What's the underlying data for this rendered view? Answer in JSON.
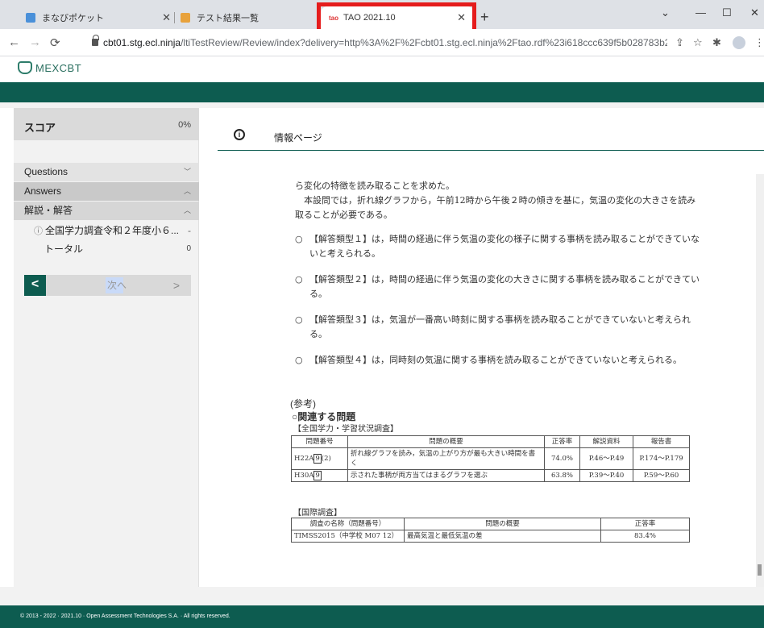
{
  "browser": {
    "tabs": [
      {
        "title": "まなびポケット",
        "state": "inactive",
        "favicon_color": "#4a90d9"
      },
      {
        "title": "テスト結果一覧",
        "state": "inactive",
        "favicon_color": "#e8a23c"
      },
      {
        "title": "TAO 2021.10",
        "state": "active",
        "favicon_text": "tao"
      }
    ],
    "url_host": "cbt01.stg.ecl.ninja",
    "url_path": "/ltiTestReview/Review/index?delivery=http%3A%2F%2Fcbt01.stg.ecl.ninja%2Ftao.rdf%23i618ccc639f5b028783b22a1d4062...",
    "highlight_color": "#e51c1c"
  },
  "app": {
    "logo_text": "MEXCBT",
    "accent_color": "#0d5c50"
  },
  "sidebar": {
    "score_label": "スコア",
    "score_value": "0%",
    "sections": [
      {
        "label": "Questions",
        "chevron": "chevron-down-icon"
      },
      {
        "label": "Answers",
        "chevron": "chevron-up-icon"
      },
      {
        "label": "解説・解答",
        "chevron": "chevron-up-icon"
      }
    ],
    "items": [
      {
        "label": "全国学力調査令和２年度小６...",
        "value": "-"
      },
      {
        "label": "トータル",
        "value": "0"
      }
    ],
    "prev_label": "<",
    "next_label": "次へ",
    "next_arrow": ">"
  },
  "main": {
    "header_title": "情報ページ",
    "intro": "ら変化の特徴を読み取ることを求めた。\n　本設問では，折れ線グラフから，午前12時から午後２時の傾きを基に，気温の変化の大きさを読み取ることが必要である。",
    "bullets": [
      "【解答類型１】は，時間の経過に伴う気温の変化の様子に関する事柄を読み取ることができていないと考えられる。",
      "【解答類型２】は，時間の経過に伴う気温の変化の大きさに関する事柄を読み取ることができている。",
      "【解答類型３】は，気温が一番高い時刻に関する事柄を読み取ることができていないと考えられる。",
      "【解答類型４】は，同時刻の気温に関する事柄を読み取ることができていないと考えられる。"
    ],
    "bullet_mark": "○",
    "reference_label": "(参考)",
    "related_label": "○関連する問題",
    "table1_caption": "【全国学力・学習状況調査】",
    "table1_headers": [
      "問題番号",
      "問題の概要",
      "正答率",
      "解説資料",
      "報告書"
    ],
    "table1_rows": [
      {
        "id_prefix": "H22A",
        "id_box": "9",
        "id_suffix": "(2)",
        "summary": "折れ線グラフを読み，気温の上がり方が最も大きい時間を書く",
        "rate": "74.0%",
        "doc": "P.46～P.49",
        "report": "P.174～P.179"
      },
      {
        "id_prefix": "H30A",
        "id_box": "9",
        "id_suffix": "",
        "summary": "示された事柄が両方当てはまるグラフを選ぶ",
        "rate": "63.8%",
        "doc": "P.39～P.40",
        "report": "P.59～P.60"
      }
    ],
    "table2_caption": "【国際調査】",
    "table2_headers": [
      "調査の名称（問題番号）",
      "問題の概要",
      "正答率"
    ],
    "table2_rows": [
      {
        "name": "TIMSS2015（中学校 M07 12）",
        "summary": "最高気温と最低気温の差",
        "rate": "83.4%"
      }
    ]
  },
  "footer": {
    "text": "© 2013 - 2022 · 2021.10 · Open Assessment Technologies S.A. · All rights reserved."
  }
}
